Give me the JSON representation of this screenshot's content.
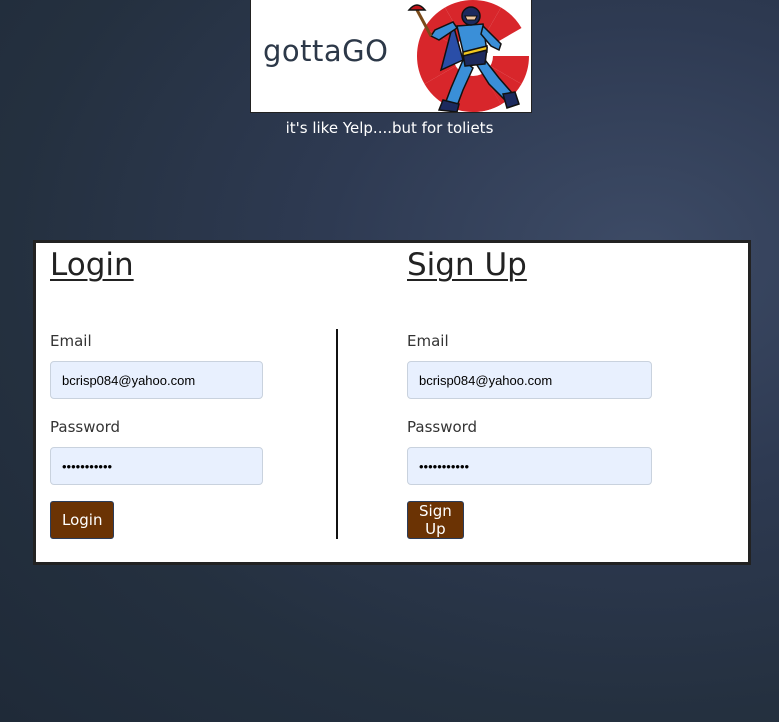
{
  "logo": {
    "text": "gottaGO",
    "image_alt": "cartoon superhero holding a plunger"
  },
  "tagline": "it's like Yelp....but for toliets",
  "login": {
    "heading": "Login",
    "email_label": "Email",
    "email_value": "bcrisp084@yahoo.com",
    "password_label": "Password",
    "password_value": "•••••••••••",
    "button_label": "Login"
  },
  "signup": {
    "heading": "Sign Up",
    "email_label": "Email",
    "email_value": "bcrisp084@yahoo.com",
    "password_label": "Password",
    "password_value": "•••••••••••",
    "button_label": "Sign Up"
  },
  "colors": {
    "button_bg": "#6b3304",
    "input_bg": "#e8f0fe",
    "page_bg": "#2e3a52"
  }
}
